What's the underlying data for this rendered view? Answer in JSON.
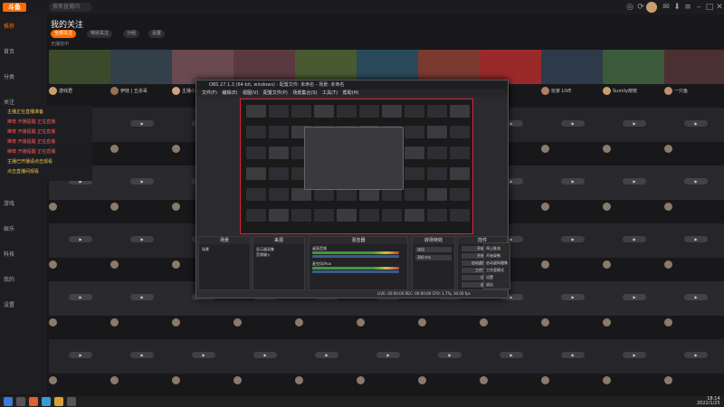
{
  "app": {
    "logo": "斗鱼",
    "search_placeholder": "搜索直播间",
    "page_title": "我的关注",
    "hint": "无播放中"
  },
  "filters": [
    {
      "label": "全部关注",
      "active": true
    },
    {
      "label": "特别关注",
      "active": false
    },
    {
      "label": "分组",
      "active": false
    },
    {
      "label": "设置",
      "active": false
    }
  ],
  "sidebar": [
    {
      "label": "推荐",
      "active": true
    },
    {
      "label": "首页",
      "active": false
    },
    {
      "label": "分类",
      "active": false
    },
    {
      "label": "关注",
      "active": false
    },
    {
      "label": "排行",
      "active": false
    },
    {
      "label": "活动",
      "active": false
    },
    {
      "label": "鱼吧",
      "active": false
    },
    {
      "label": "游戏",
      "active": false
    },
    {
      "label": "娱乐",
      "active": false
    },
    {
      "label": "科技",
      "active": false
    },
    {
      "label": "我的",
      "active": false
    },
    {
      "label": "设置",
      "active": false
    }
  ],
  "notifications": [
    {
      "text": "主播正在直播准备",
      "color": "#f5c542"
    },
    {
      "text": "推荐 开播提醒 正在直播",
      "color": "#ff5555"
    },
    {
      "text": "推荐 开播提醒 正在直播",
      "color": "#ff5555"
    },
    {
      "text": "推荐 开播提醒 正在直播",
      "color": "#ff5555"
    },
    {
      "text": "推荐 开播提醒 正在直播",
      "color": "#ff5555"
    },
    {
      "text": "主播已开播请点击观看",
      "color": "#f5c542"
    },
    {
      "text": "点击直播间观看",
      "color": "#f5c542"
    }
  ],
  "obs": {
    "title": "OBS 27.1.3 (64-bit, windows) - 配置文件: 未命名 - 场景: 未命名",
    "menu": "文件(F) 编辑(E) 视图(V) 配置文件(P) 场景集合(S) 工具(T) 帮助(H)",
    "docks": [
      "场景",
      "来源",
      "混音器",
      "转场特效",
      "控件"
    ],
    "scene": "场景",
    "sources": [
      "显示器采集",
      "音频输入"
    ],
    "mixer": [
      "桌面音频",
      "麦克风/Aux"
    ],
    "transition": "淡出",
    "duration": "300 ms",
    "controls": [
      "开始直播",
      "开始录制",
      "启动虚拟摄像机",
      "工作室模式",
      "设置",
      "退出"
    ],
    "status": "LIVE: 00:00:00  REC: 00:00:00  CPU: 1.7%, 30.00 fps",
    "context": [
      "停止推流",
      "开始录制",
      "启动虚拟摄像",
      "工作室模式",
      "设置",
      "退出"
    ]
  },
  "cards": [
    {
      "name": "游戏君",
      "date": "",
      "rec": "",
      "color": "#3b4a2a",
      "ava": "#c8a070"
    },
    {
      "name": "伊娃 | 五杀哥",
      "date": "",
      "rec": "",
      "color": "#33404a",
      "ava": "#9a7050"
    },
    {
      "name": "主播小姐姐",
      "date": "",
      "rec": "",
      "color": "#6a4a50",
      "ava": "#d0a080"
    },
    {
      "name": "DNF 直播",
      "date": "",
      "rec": "",
      "color": "#5a3a40",
      "ava": "#c07060"
    },
    {
      "name": "炉石传说",
      "date": "",
      "rec": "",
      "color": "#4a5a30",
      "ava": "#c8a070"
    },
    {
      "name": "英雄联盟",
      "date": "",
      "rec": "",
      "color": "#2a4a5a",
      "ava": "#a08060"
    },
    {
      "name": "大主播",
      "date": "",
      "rec": "",
      "color": "#7a3a30",
      "ava": "#c08070"
    },
    {
      "name": "开黑啦",
      "date": "",
      "rec": "",
      "color": "#9a2a2a",
      "ava": "#d0a080"
    },
    {
      "name": "玩家 LIVE",
      "date": "",
      "rec": "",
      "color": "#2e3a4a",
      "ava": "#b08060"
    },
    {
      "name": "Sumily晓晓",
      "date": "",
      "rec": "",
      "color": "#3a5a3a",
      "ava": "#c8a070"
    },
    {
      "name": "一只鱼",
      "date": "",
      "rec": "",
      "color": "#4a3030",
      "ava": "#c09070"
    }
  ],
  "taskbar": {
    "time": "18:14",
    "date": "2022/1/25"
  }
}
